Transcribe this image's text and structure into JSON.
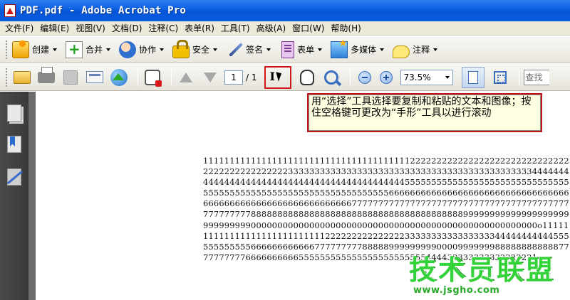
{
  "window": {
    "title": "PDF.pdf - Adobe Acrobat Pro"
  },
  "menu": [
    "文件(F)",
    "编辑(E)",
    "视图(V)",
    "文档(D)",
    "注释(C)",
    "表单(R)",
    "工具(T)",
    "高级(A)",
    "窗口(W)",
    "帮助(H)"
  ],
  "tasks": {
    "create": "创建",
    "combine": "合并",
    "collaborate": "协作",
    "secure": "安全",
    "sign": "签名",
    "forms": "表单",
    "multimedia": "多媒体",
    "comment": "注释"
  },
  "toolbar": {
    "page_current": "1",
    "page_total": "/ 1",
    "zoom": "73.5%",
    "search_placeholder": "查找"
  },
  "tooltip": {
    "text": "用“选择”工具选择要复制和粘贴的文本和图像；按住空格键可更改为“手形”工具以进行滚动"
  },
  "document": {
    "body": "111111111111111111111111111111111111111222222222222222222222222222222222222222222222233333333333333333333333333333333333333333333334444444444444444444444444444444444444444444445555555555555555555555555555555555555555555555555555555555555555556666666666666666666666666666666666666666666666666666666666666677777777777777777777777777777777777777777777777777888888888888888888888888888888888888888899999999999999999999999999999000000000000000000000000000000000000000000000000000000o11111111111111111111111111112222222222222223333333333333333344444444444555555555555666666666666777777777888889999999990000999999988888888888877777777776666666666555555555555555555555555444433333333332222221"
  },
  "watermark": {
    "logo": "技术员联盟",
    "url": "www.jsgho.com"
  },
  "colors": {
    "titlebar": "#0a5fe0",
    "highlight": "#c01818",
    "tooltip_bg": "#ffffe1"
  }
}
